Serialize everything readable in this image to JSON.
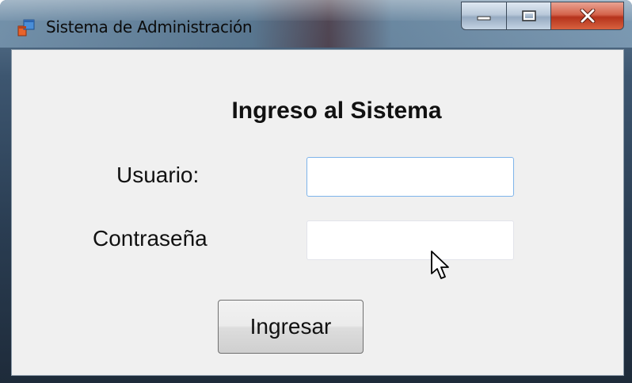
{
  "window": {
    "title": "Sistema de Administración",
    "icon": "windows-form-icon",
    "controls": {
      "minimize": "minimize-icon",
      "maximize": "maximize-icon",
      "close": "close-icon"
    }
  },
  "form": {
    "heading": "Ingreso al Sistema",
    "username_label": "Usuario:",
    "username_value": "",
    "password_label": "Contraseña",
    "password_value": "",
    "submit_label": "Ingresar"
  },
  "colors": {
    "client_background": "#f0f0f0",
    "focused_border": "#7eb4ea",
    "close_button": "#c8452a"
  }
}
